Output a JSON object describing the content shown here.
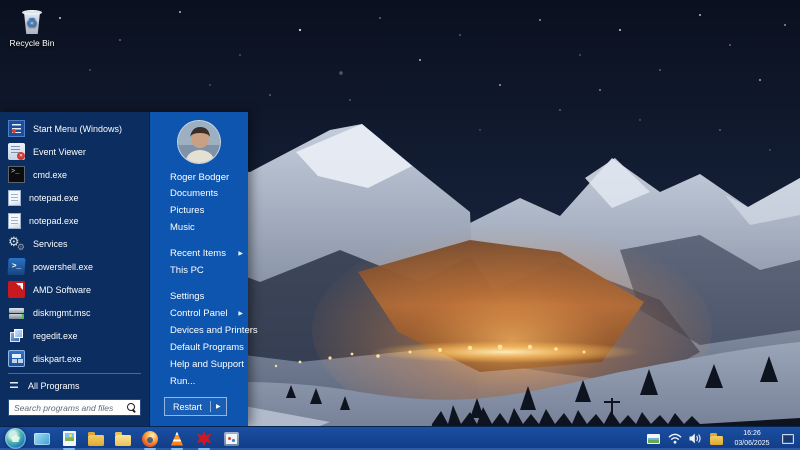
{
  "theme": {
    "menu_left_bg": "#0b2d60",
    "menu_right_bg": "#0e55b0",
    "taskbar_top": "#1a4fa2",
    "taskbar_bottom": "#123c86",
    "text_color": "#ffffff",
    "warm_glow": "#ff9a3c"
  },
  "desktop": {
    "recycle_bin_label": "Recycle Bin"
  },
  "start_menu": {
    "left_items": [
      {
        "label": "Start Menu (Windows)",
        "icon": "startmenu"
      },
      {
        "label": "Event Viewer",
        "icon": "eventviewer"
      },
      {
        "label": "cmd.exe",
        "icon": "cmd"
      },
      {
        "label": "notepad.exe",
        "icon": "notepad"
      },
      {
        "label": "notepad.exe",
        "icon": "notepad"
      },
      {
        "label": "Services",
        "icon": "services"
      },
      {
        "label": "powershell.exe",
        "icon": "powershell"
      },
      {
        "label": "AMD Software",
        "icon": "amd"
      },
      {
        "label": "diskmgmt.msc",
        "icon": "diskmgmt"
      },
      {
        "label": "regedit.exe",
        "icon": "regedit"
      },
      {
        "label": "diskpart.exe",
        "icon": "diskpart"
      }
    ],
    "all_programs_label": "All Programs",
    "search_placeholder": "Search programs and files",
    "user_name": "Roger Bodger",
    "right_items": [
      {
        "label": "Documents",
        "submenu": false,
        "gap_after": false
      },
      {
        "label": "Pictures",
        "submenu": false,
        "gap_after": false
      },
      {
        "label": "Music",
        "submenu": false,
        "gap_after": true
      },
      {
        "label": "Recent Items",
        "submenu": true,
        "gap_after": false
      },
      {
        "label": "This PC",
        "submenu": false,
        "gap_after": true
      },
      {
        "label": "Settings",
        "submenu": false,
        "gap_after": false
      },
      {
        "label": "Control Panel",
        "submenu": true,
        "gap_after": false
      },
      {
        "label": "Devices and Printers",
        "submenu": false,
        "gap_after": false
      },
      {
        "label": "Default Programs",
        "submenu": false,
        "gap_after": false
      },
      {
        "label": "Help and Support",
        "submenu": false,
        "gap_after": false
      },
      {
        "label": "Run...",
        "submenu": false,
        "gap_after": false
      }
    ],
    "restart_label": "Restart"
  },
  "taskbar": {
    "pinned": [
      {
        "name": "monitor-app",
        "running": false
      },
      {
        "name": "image-viewer",
        "running": true
      },
      {
        "name": "folder-dark",
        "running": false
      },
      {
        "name": "folder-light",
        "running": false
      },
      {
        "name": "firefox",
        "running": true
      },
      {
        "name": "vlc",
        "running": true
      },
      {
        "name": "amd-radeon",
        "running": true
      },
      {
        "name": "paint-app",
        "running": false
      }
    ],
    "tray": {
      "time": "16:26",
      "date": "03/06/2025"
    }
  }
}
